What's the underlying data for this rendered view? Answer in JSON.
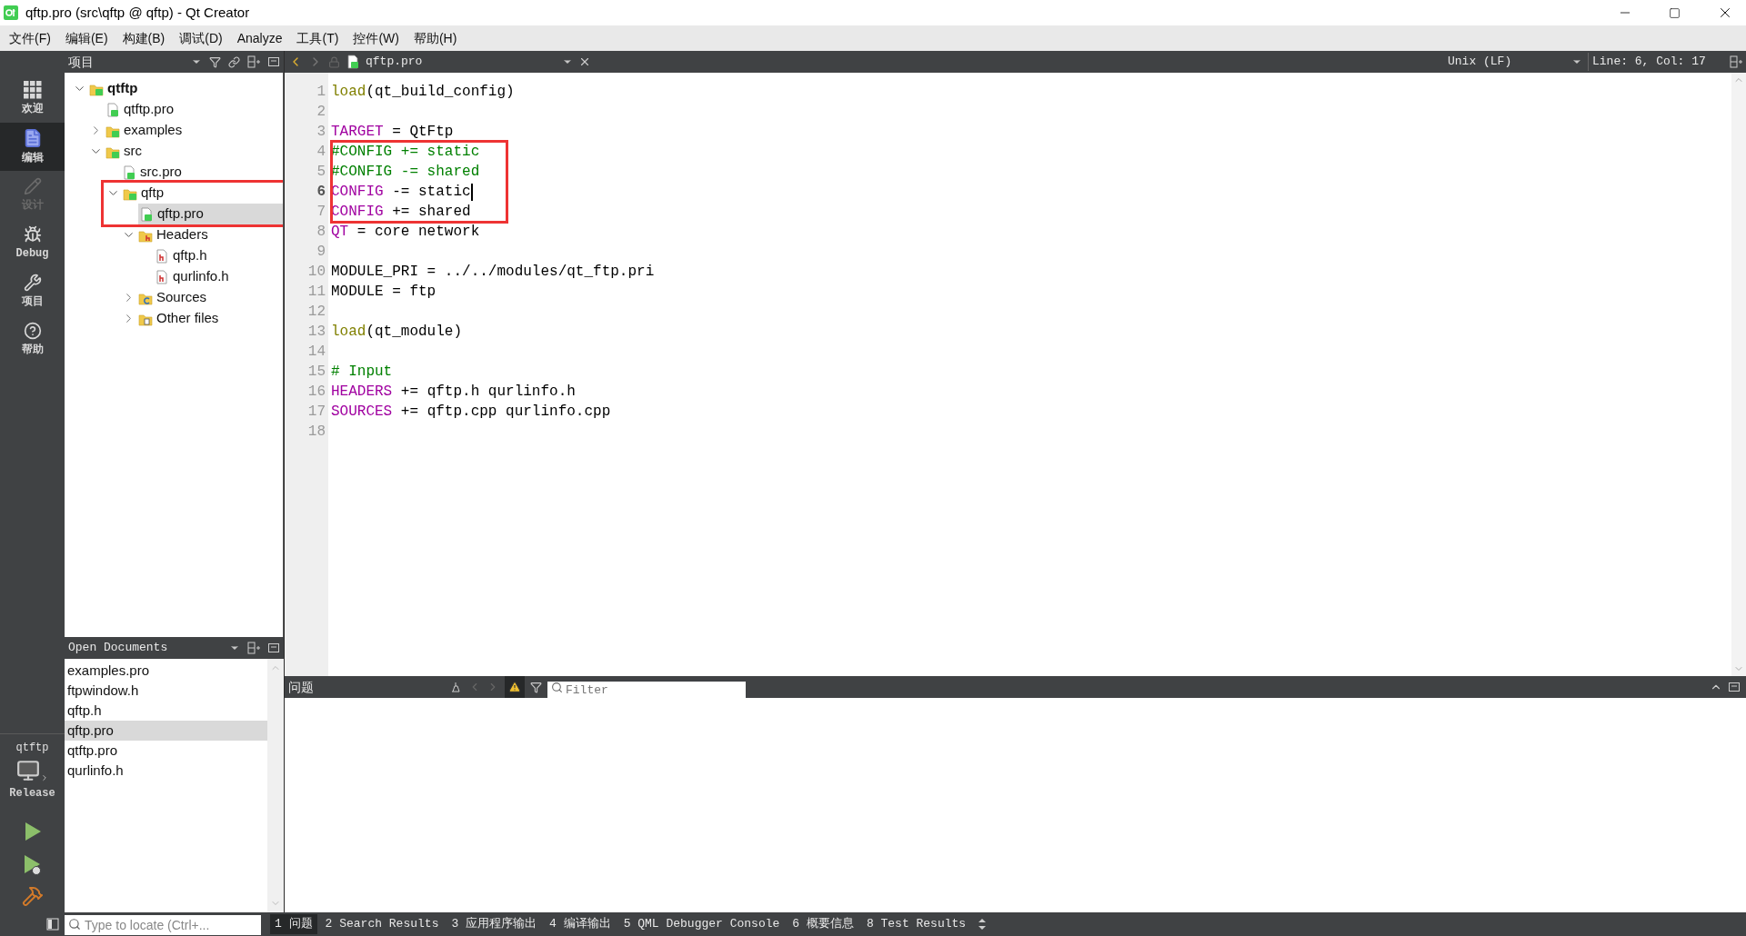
{
  "window": {
    "title": "qftp.pro (src\\qftp @ qftp) - Qt Creator"
  },
  "menu": [
    "文件(F)",
    "编辑(E)",
    "构建(B)",
    "调试(D)",
    "Analyze",
    "工具(T)",
    "控件(W)",
    "帮助(H)"
  ],
  "mode_bar": {
    "items": [
      {
        "kind": "welcome",
        "label": "欢迎",
        "selected": false,
        "disabled": false
      },
      {
        "kind": "edit",
        "label": "编辑",
        "selected": true,
        "disabled": false
      },
      {
        "kind": "design",
        "label": "设计",
        "selected": false,
        "disabled": true
      },
      {
        "kind": "debug",
        "label": "Debug",
        "selected": false,
        "disabled": false
      },
      {
        "kind": "projects",
        "label": "项目",
        "selected": false,
        "disabled": false
      },
      {
        "kind": "help",
        "label": "帮助",
        "selected": false,
        "disabled": false
      }
    ],
    "target": {
      "project": "qtftp",
      "config": "Release"
    }
  },
  "project_panel": {
    "title": "项目",
    "tree": [
      {
        "label": "qtftp",
        "kind": "project",
        "expanded": true,
        "selected": false,
        "annotated": false,
        "children": [
          {
            "label": "qtftp.pro",
            "kind": "pro",
            "selected": false,
            "annotated": false
          },
          {
            "label": "examples",
            "kind": "project",
            "expanded": false,
            "selected": false,
            "annotated": false
          },
          {
            "label": "src",
            "kind": "project",
            "expanded": true,
            "selected": false,
            "annotated": false,
            "children": [
              {
                "label": "src.pro",
                "kind": "pro",
                "selected": false,
                "annotated": false
              },
              {
                "label": "qftp",
                "kind": "project",
                "expanded": true,
                "selected": false,
                "annotated": true,
                "children": [
                  {
                    "label": "qftp.pro",
                    "kind": "pro",
                    "selected": true,
                    "annotated": true
                  },
                  {
                    "label": "Headers",
                    "kind": "headers",
                    "expanded": true,
                    "selected": false,
                    "annotated": false,
                    "children": [
                      {
                        "label": "qftp.h",
                        "kind": "header",
                        "selected": false,
                        "annotated": false
                      },
                      {
                        "label": "qurlinfo.h",
                        "kind": "header",
                        "selected": false,
                        "annotated": false
                      }
                    ]
                  },
                  {
                    "label": "Sources",
                    "kind": "sources",
                    "expanded": false,
                    "selected": false,
                    "annotated": false
                  },
                  {
                    "label": "Other files",
                    "kind": "other",
                    "expanded": false,
                    "selected": false,
                    "annotated": false
                  }
                ]
              }
            ]
          }
        ]
      }
    ]
  },
  "open_documents": {
    "title": "Open Documents",
    "items": [
      {
        "label": "examples.pro",
        "selected": false
      },
      {
        "label": "ftpwindow.h",
        "selected": false
      },
      {
        "label": "qftp.h",
        "selected": false
      },
      {
        "label": "qftp.pro",
        "selected": true
      },
      {
        "label": "qtftp.pro",
        "selected": false
      },
      {
        "label": "qurlinfo.h",
        "selected": false
      }
    ]
  },
  "editor": {
    "file": "qftp.pro",
    "line_ending": "Unix (LF)",
    "position": "Line: 6, Col: 17",
    "lines": [
      {
        "number": "1",
        "current": false,
        "annotated": false,
        "tokens": [
          {
            "kind": "function",
            "text": "load"
          },
          {
            "kind": "plain",
            "text": "(qt_build_config)"
          }
        ]
      },
      {
        "number": "2",
        "current": false,
        "annotated": false
      },
      {
        "number": "3",
        "current": false,
        "annotated": false,
        "tokens": [
          {
            "kind": "keyword",
            "text": "TARGET"
          },
          {
            "kind": "plain",
            "text": " = QtFtp"
          }
        ]
      },
      {
        "number": "4",
        "current": false,
        "annotated": true,
        "tokens": [
          {
            "kind": "comment",
            "text": "#CONFIG += static"
          }
        ]
      },
      {
        "number": "5",
        "current": false,
        "annotated": true,
        "tokens": [
          {
            "kind": "comment",
            "text": "#CONFIG -= shared"
          }
        ]
      },
      {
        "number": "6",
        "current": true,
        "annotated": true,
        "tokens": [
          {
            "kind": "keyword",
            "text": "CONFIG"
          },
          {
            "kind": "plain",
            "text": " -= static"
          }
        ]
      },
      {
        "number": "7",
        "current": false,
        "annotated": true,
        "tokens": [
          {
            "kind": "keyword",
            "text": "CONFIG"
          },
          {
            "kind": "plain",
            "text": " += shared"
          }
        ]
      },
      {
        "number": "8",
        "current": false,
        "annotated": false,
        "tokens": [
          {
            "kind": "keyword",
            "text": "QT"
          },
          {
            "kind": "plain",
            "text": " = core network"
          }
        ]
      },
      {
        "number": "9",
        "current": false,
        "annotated": false
      },
      {
        "number": "10",
        "current": false,
        "annotated": false,
        "tokens": [
          {
            "kind": "plain",
            "text": "MODULE_PRI = ../../modules/qt_ftp.pri"
          }
        ]
      },
      {
        "number": "11",
        "current": false,
        "annotated": false,
        "tokens": [
          {
            "kind": "plain",
            "text": "MODULE = ftp"
          }
        ]
      },
      {
        "number": "12",
        "current": false,
        "annotated": false
      },
      {
        "number": "13",
        "current": false,
        "annotated": false,
        "tokens": [
          {
            "kind": "function",
            "text": "load"
          },
          {
            "kind": "plain",
            "text": "(qt_module)"
          }
        ]
      },
      {
        "number": "14",
        "current": false,
        "annotated": false
      },
      {
        "number": "15",
        "current": false,
        "annotated": false,
        "tokens": [
          {
            "kind": "comment",
            "text": "# Input"
          }
        ]
      },
      {
        "number": "16",
        "current": false,
        "annotated": false,
        "tokens": [
          {
            "kind": "keyword",
            "text": "HEADERS"
          },
          {
            "kind": "plain",
            "text": " += qftp.h qurlinfo.h"
          }
        ]
      },
      {
        "number": "17",
        "current": false,
        "annotated": false,
        "tokens": [
          {
            "kind": "keyword",
            "text": "SOURCES"
          },
          {
            "kind": "plain",
            "text": " += qftp.cpp qurlinfo.cpp"
          }
        ]
      },
      {
        "number": "18",
        "current": false,
        "annotated": false
      }
    ]
  },
  "issues": {
    "title": "问题",
    "filter_placeholder": "Filter"
  },
  "status_bar": {
    "locate_placeholder": "Type to locate (Ctrl+...",
    "tabs": [
      {
        "label": "1 问题",
        "selected": true
      },
      {
        "label": "2 Search Results",
        "selected": false
      },
      {
        "label": "3 应用程序输出",
        "selected": false
      },
      {
        "label": "4 编译输出",
        "selected": false
      },
      {
        "label": "5 QML Debugger Console",
        "selected": false
      },
      {
        "label": "6 概要信息",
        "selected": false
      },
      {
        "label": "8 Test Results",
        "selected": false
      }
    ]
  }
}
